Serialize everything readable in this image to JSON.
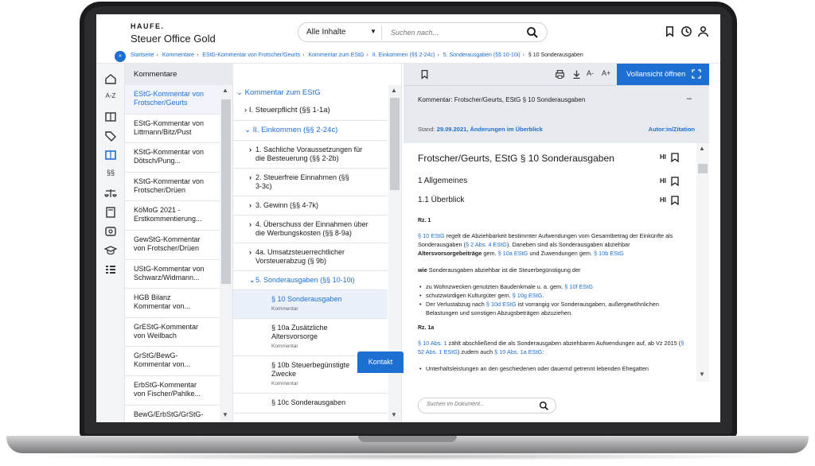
{
  "header": {
    "logo": "HAUFE.",
    "product": "Steuer Office Gold",
    "scope": "Alle Inhalte",
    "search_placeholder": "Suchen nach..."
  },
  "breadcrumb": {
    "toggle": "»",
    "items": [
      "Startseite",
      "Kommentare",
      "EStG-Kommentar von Frotscher/Geurts",
      "Kommentar zum EStG",
      "II. Einkommen (§§ 2-24c)",
      "5. Sonderausgaben (§§ 10-10i)"
    ],
    "current": "§ 10 Sonderausgaben"
  },
  "rail": {
    "items": [
      "home-icon",
      "a-z-icon",
      "book-icon",
      "tag-icon",
      "commentary-icon",
      "paragraph-icon",
      "scales-icon",
      "calculator-icon",
      "media-icon",
      "graduation-icon",
      "list-icon"
    ],
    "az_label": "A-Z",
    "para_label": "§§"
  },
  "col1": {
    "header": "Kommentare",
    "items": [
      {
        "line1": "EStG-Kommentar von",
        "line2": "Frotscher/Geurts"
      },
      {
        "line1": "EStG-Kommentar von",
        "line2": "Littmann/Bitz/Pust"
      },
      {
        "line1": "KStG-Kommentar von",
        "line2": "Dötsch/Pung..."
      },
      {
        "line1": "KStG-Kommentar von",
        "line2": "Frotscher/Drüen"
      },
      {
        "line1": "KöMoG 2021 -",
        "line2": "Erstkommentierung..."
      },
      {
        "line1": "GewStG-Kommentar",
        "line2": "von Frotscher/Drüen"
      },
      {
        "line1": "UStG-Kommentar von",
        "line2": "Schwarz/Widmann..."
      },
      {
        "line1": "HGB Bilanz",
        "line2": "Kommentar von..."
      },
      {
        "line1": "GrEStG-Kommentar",
        "line2": "von Weilbach"
      },
      {
        "line1": "GrStG/BewG-",
        "line2": "Kommentar von..."
      },
      {
        "line1": "ErbStG-Kommentar",
        "line2": "von Fischer/Pahlke..."
      },
      {
        "line1": "BewG/ErbStG/GrStG-",
        "line2": ""
      }
    ]
  },
  "col2": {
    "root": "Kommentar zum EStG",
    "l1_a": "I. Steuerpflicht (§§ 1-1a)",
    "l1_b": "II. Einkommen (§§ 2-24c)",
    "l2": [
      {
        "line1": "1. Sachliche Voraussetzungen für",
        "line2": "die Besteuerung (§§ 2-2b)"
      },
      {
        "line1": "2. Steuerfreie Einnahmen (§§",
        "line2": "3-3c)"
      },
      {
        "line1": "3. Gewinn (§§ 4-7k)",
        "line2": ""
      },
      {
        "line1": "4. Überschuss der Einnahmen über",
        "line2": "die Werbungskosten (§§ 8-9a)"
      },
      {
        "line1": "4a. Umsatzsteuerrechtlicher",
        "line2": "Vorsteuerabzug (§ 9b)"
      }
    ],
    "l2_open": "5. Sonderausgaben (§§ 10-10i)",
    "l3": [
      {
        "line1": "§ 10 Sonderausgaben",
        "line2": "",
        "sub": "Kommentar"
      },
      {
        "line1": "§ 10a Zusätzliche",
        "line2": "Altersvorsorge",
        "sub": "Kommentar"
      },
      {
        "line1": "§ 10b Steuerbegünstigte",
        "line2": "Zwecke",
        "sub": "Kommentar"
      },
      {
        "line1": "§ 10c Sonderausgaben",
        "line2": "",
        "sub": ""
      }
    ]
  },
  "doc": {
    "fullview": "Vollansicht öffnen",
    "font_smaller": "A-",
    "font_larger": "A+",
    "meta_title": "Kommentar: Frotscher/Geurts, EStG § 10 Sonderausgaben",
    "meta_min": "–",
    "stand_label": "Stand:",
    "stand_value": "29.09.2021, Änderungen im Überblick",
    "author": "Autor:in/Zitation",
    "h1": "Frotscher/Geurts, EStG § 10 Sonderausgaben",
    "h2a": "1 Allgemeines",
    "h2b": "1.1 Überblick",
    "hi": "HI",
    "rz1": "Rz. 1",
    "p1": {
      "l1": "§ 10 EStG",
      "t1": " regelt die Abziehbarkeit bestimmter Aufwendungen vom Gesamtbetrag der Einkünfte als Sonderausgaben (",
      "l2": "§ 2 Abs. 4 EStG",
      "t2": "). Daneben sind als Sonderausgaben abziehbar ",
      "b1": "Altersvorsorgebeiträge",
      "t3": " gem. ",
      "l3": "§ 10a EStG",
      "t4": " und Zuwendungen gem. ",
      "l4": "§ 10b EStG"
    },
    "p2_bold": "wie",
    "p2": " Sonderausgaben abziehbar ist die Steuerbegünstigung der",
    "li1_t": "zu Wohnzwecken genutzten Baudenkmale u. a. gem. ",
    "li1_l": "§ 10f EStG",
    "li2_t": "schutzwürdigen Kulturgüter gem. ",
    "li2_l": "§ 10g EStG",
    "li2_e": ".",
    "li3_t1": "Der Verlustabzug nach ",
    "li3_l": "§ 10d EStG",
    "li3_t2": " ist vorrangig vor Sonderausgaben, außergewöhnlichen Belastungen und sonstigen Abzugsbeträgen abzuziehen.",
    "rz1a": "Rz. 1a",
    "p3_l1": "§ 10 Abs. 1",
    "p3_t1": " zählt abschließend die als Sonderausgaben abziehbaren Aufwendungen auf, ab Vz 2015 (",
    "p3_l2": "§ 52 Abs. 1 EStG",
    "p3_t2": ") zudem auch ",
    "p3_l3": "§ 10 Abs. 1a EStG",
    "p3_t3": ":",
    "li4": "Unterhaltsleistungen an den geschiedenen oder dauernd getrennt lebenden Ehegatten",
    "search_placeholder": "Suchen im Dokument...",
    "kontakt": "Kontakt"
  }
}
